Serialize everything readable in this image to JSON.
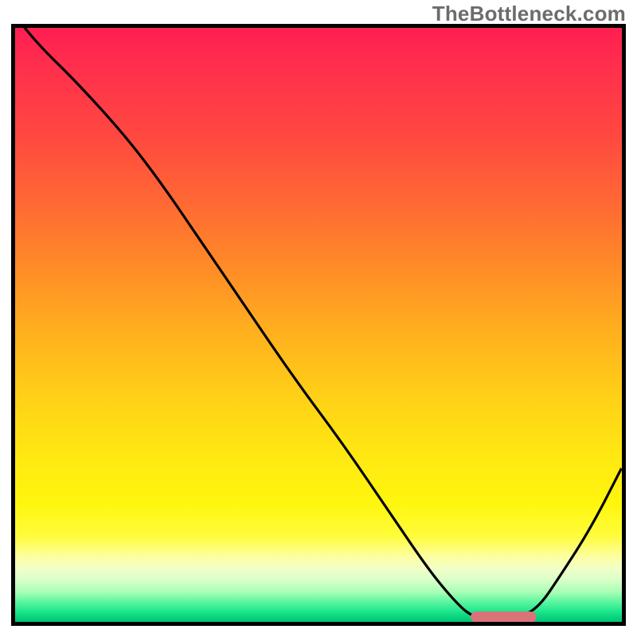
{
  "watermark": "TheBottleneck.com",
  "colors": {
    "curve": "#000000",
    "marker": "#d97379",
    "border": "#000000"
  },
  "chart_data": {
    "type": "line",
    "title": "",
    "xlabel": "",
    "ylabel": "",
    "xlim": [
      0,
      100
    ],
    "ylim": [
      0,
      100
    ],
    "grid": false,
    "legend": false,
    "x": [
      0,
      4,
      10,
      18,
      24,
      30,
      38,
      46,
      54,
      62,
      68,
      72,
      75,
      78,
      82,
      86,
      90,
      95,
      100
    ],
    "values": [
      102,
      97,
      91,
      82,
      74,
      65,
      53,
      41,
      30,
      18,
      9,
      4,
      1,
      0.5,
      0.5,
      2,
      8,
      16,
      26
    ],
    "marker": {
      "x_start": 76,
      "x_end": 85,
      "y": 0.8
    },
    "notes": "Y-axis represents bottleneck severity (background: red=high at top, green=low at bottom). Curve dips to ~0 around x≈78–82 (the sweet spot marked in pink) then rises again."
  }
}
